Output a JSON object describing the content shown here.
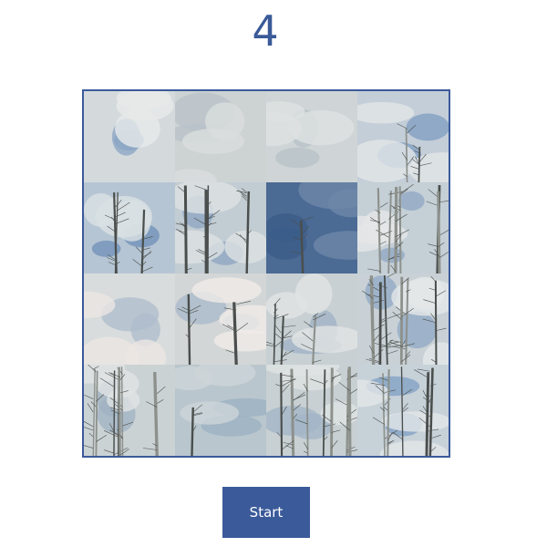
{
  "game": {
    "counter": "4"
  },
  "board": {
    "rows": 4,
    "cols": 4,
    "tiles": [
      {
        "sky": "#d4dadc",
        "cloud": "#e7eaea",
        "blue": "#8aa4c4",
        "trees": 0,
        "scene": "sky-patch"
      },
      {
        "sky": "#cdd3d3",
        "cloud": "#d9dddd",
        "blue": "#b8c2c8",
        "trees": 0,
        "scene": "clouds"
      },
      {
        "sky": "#cfd5d6",
        "cloud": "#dde1e1",
        "blue": "#b7c1c7",
        "trees": 0,
        "scene": "clouds"
      },
      {
        "sky": "#c4ced8",
        "cloud": "#e2e6e7",
        "blue": "#7e9cc0",
        "trees": 2,
        "scene": "tree-tops"
      },
      {
        "sky": "#b6c5d3",
        "cloud": "#dbe1e4",
        "blue": "#6e8fb8",
        "trees": 3,
        "scene": "branches"
      },
      {
        "sky": "#c2ccd3",
        "cloud": "#dde2e3",
        "blue": "#8ca6c2",
        "trees": 4,
        "scene": "trunks"
      },
      {
        "sky": "#4b6a94",
        "cloud": "#6d87a8",
        "blue": "#3b5c88",
        "trees": 1,
        "scene": "dark-sky"
      },
      {
        "sky": "#c5cfd6",
        "cloud": "#e3e6e7",
        "blue": "#8ea7c3",
        "trees": 6,
        "scene": "trunks"
      },
      {
        "sky": "#d8dcdc",
        "cloud": "#ece6e4",
        "blue": "#aebccc",
        "trees": 0,
        "scene": "clouds"
      },
      {
        "sky": "#d3d6d6",
        "cloud": "#f0ebe8",
        "blue": "#a8b8ca",
        "trees": 2,
        "scene": "branches"
      },
      {
        "sky": "#c8d0d4",
        "cloud": "#e1e4e4",
        "blue": "#9fb2c6",
        "trees": 3,
        "scene": "branches"
      },
      {
        "sky": "#c9d1d6",
        "cloud": "#e4e7e8",
        "blue": "#8fa8c4",
        "trees": 6,
        "scene": "trunks"
      },
      {
        "sky": "#cbd2d4",
        "cloud": "#e0e3e3",
        "blue": "#9fb1c3",
        "trees": 7,
        "scene": "trunks"
      },
      {
        "sky": "#b9c6cd",
        "cloud": "#cdd5d8",
        "blue": "#9bb0c2",
        "trees": 1,
        "scene": "branches"
      },
      {
        "sky": "#c8d0d3",
        "cloud": "#dee2e2",
        "blue": "#a2b4c5",
        "trees": 7,
        "scene": "trunks"
      },
      {
        "sky": "#c7d1d8",
        "cloud": "#e2e6e8",
        "blue": "#7f9fc4",
        "trees": 5,
        "scene": "trunks"
      }
    ]
  },
  "controls": {
    "start_label": "Start"
  },
  "colors": {
    "accent": "#3b5a9a",
    "counter": "#3a5a98"
  }
}
